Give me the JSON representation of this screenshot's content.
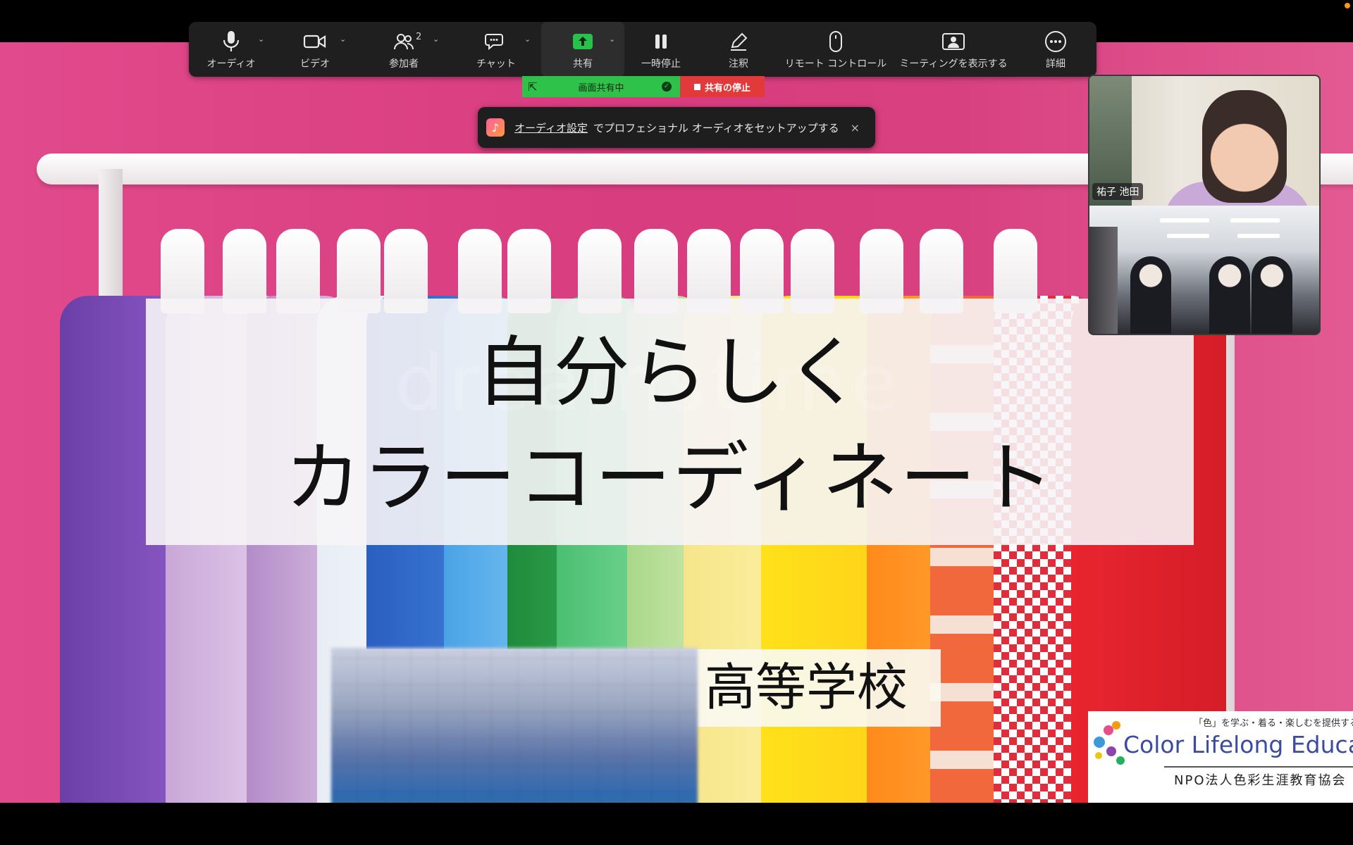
{
  "toolbar": {
    "audio": "オーディオ",
    "video": "ビデオ",
    "participants": "参加者",
    "participants_count": "2",
    "chat": "チャット",
    "share": "共有",
    "pause": "一時停止",
    "annotate": "注釈",
    "remote_control": "リモート コントロール",
    "show_meeting": "ミーティングを表示する",
    "more": "詳細"
  },
  "share_bar": {
    "sharing": "画面共有中",
    "stop": "共有の停止"
  },
  "notification": {
    "link": "オーディオ設定",
    "text": "でプロフェショナル オーディオをセットアップする",
    "close": "×"
  },
  "video_panel": {
    "participant_name": "祐子 池田"
  },
  "slide": {
    "title_line1": "自分らしく",
    "title_line2": "カラーコーディネート",
    "school": "高等学校",
    "logo_tagline": "「色」を学ぶ・着る・楽しむを提供する団体",
    "logo_brand": "Color Lifelong Education",
    "logo_npo": "NPO法人色彩生涯教育協会"
  },
  "colors": {
    "slide_bg": "#d83d7f",
    "toolbar_bg": "#1f1f1f",
    "share_green": "#2fc24a",
    "stop_red": "#e23a3a"
  }
}
